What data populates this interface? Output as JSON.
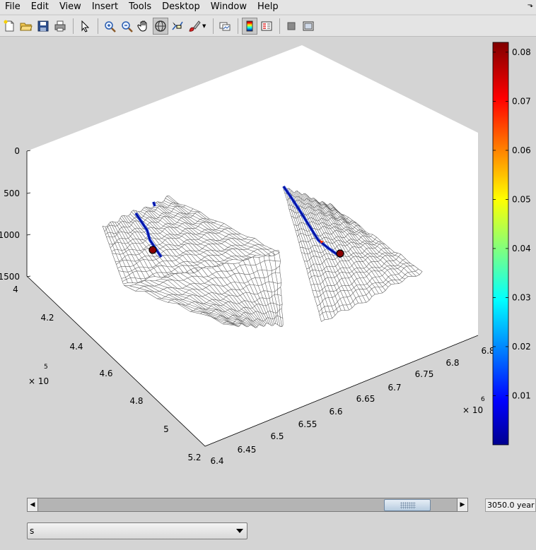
{
  "menu": [
    "File",
    "Edit",
    "View",
    "Insert",
    "Tools",
    "Desktop",
    "Window",
    "Help"
  ],
  "dock_arrow": "⬎",
  "toolbar": {
    "groups": [
      [
        "new-figure-icon",
        "open-file-icon",
        "save-icon",
        "print-icon"
      ],
      [
        "pointer-icon"
      ],
      [
        "zoom-in-icon",
        "zoom-out-icon",
        "pan-hand-icon",
        "rotate-3d-icon",
        "data-cursor-icon",
        "brush-icon"
      ],
      [
        "link-plot-icon"
      ],
      [
        "colorbar-icon",
        "legend-icon"
      ],
      [
        "hide-plot-tools-icon",
        "show-plot-tools-icon"
      ]
    ],
    "active": [
      "rotate-3d-icon",
      "colorbar-icon"
    ]
  },
  "colors": {
    "axes_face": "#ffffff",
    "mesh": "#595959",
    "colormap": "jet"
  },
  "plot": {
    "z_ticks": [
      "0",
      "500",
      "1000",
      "1500"
    ],
    "x_ticks": [
      "4",
      "4.2",
      "4.4",
      "4.6",
      "4.8",
      "5",
      "5.2"
    ],
    "x_exponent": {
      "base": "× 10",
      "power": "5"
    },
    "y_ticks": [
      "6.4",
      "6.45",
      "6.5",
      "6.55",
      "6.6",
      "6.65",
      "6.7",
      "6.75",
      "6.8",
      "6.8"
    ],
    "y_exponent": {
      "base": "× 10",
      "power": "6"
    },
    "colorbar": {
      "ticks": [
        "0.08",
        "0.07",
        "0.06",
        "0.05",
        "0.04",
        "0.03",
        "0.02",
        "0.01"
      ],
      "min": 0,
      "max": 0.082
    }
  },
  "slider": {
    "left_arrow": "◀",
    "right_arrow": "▶",
    "position": 0.93
  },
  "time_label": "3050.0 year",
  "field_select": {
    "value": "s"
  }
}
